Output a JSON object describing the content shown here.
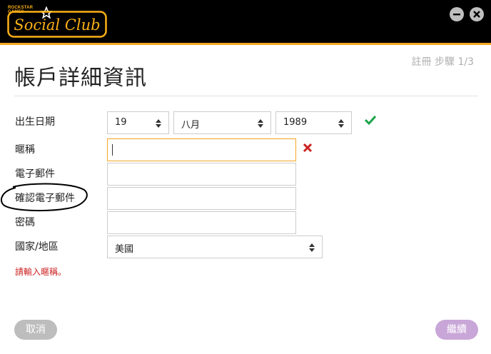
{
  "header": {
    "brand_small_line1": "ROCKSTAR",
    "brand_small_line2": "GAMES",
    "logo_text": "Social Club",
    "accent_color": "#f5a623"
  },
  "step_indicator": "註冊 步驟 1/3",
  "title": "帳戶詳細資訊",
  "fields": {
    "birthdate": {
      "label": "出生日期",
      "day": "19",
      "month": "八月",
      "year": "1989",
      "status_icon": "checkmark-icon"
    },
    "nickname": {
      "label": "暱稱",
      "value": "",
      "status_icon": "cross-icon"
    },
    "email": {
      "label": "電子郵件",
      "value": ""
    },
    "confirm_email": {
      "label": "確認電子郵件",
      "value": ""
    },
    "password": {
      "label": "密碼",
      "value": ""
    },
    "country": {
      "label": "國家/地區",
      "value": "美國"
    }
  },
  "error_message": "請輸入暱稱。",
  "buttons": {
    "cancel": "取消",
    "continue": "繼續"
  },
  "colors": {
    "valid_green": "#1aa34a",
    "error_red": "#cc2222",
    "continue_button": "#c9a6d8"
  }
}
